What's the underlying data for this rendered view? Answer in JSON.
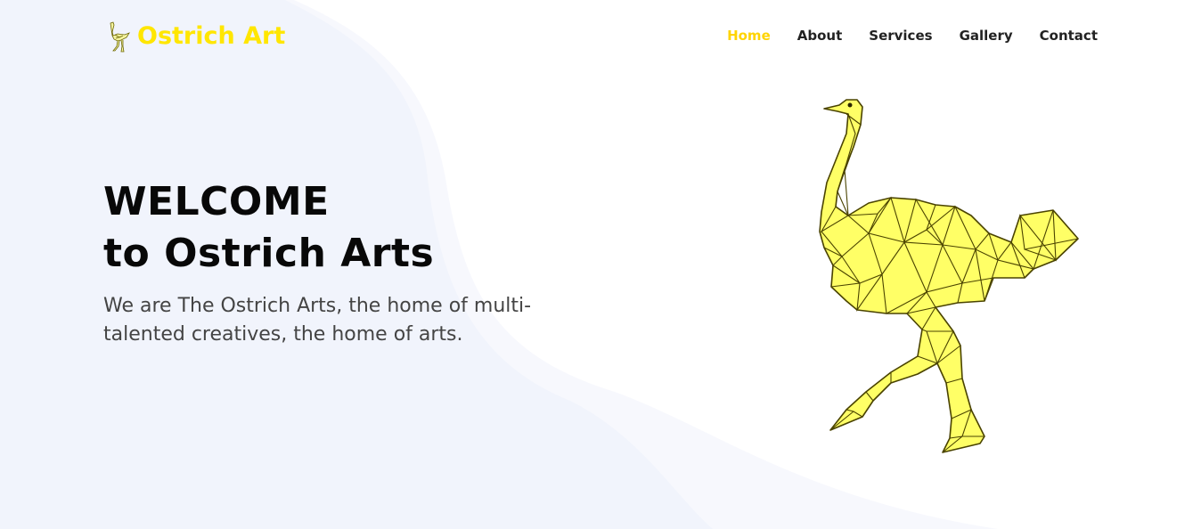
{
  "brand": {
    "name": "Ostrich Art",
    "color": "#ffe600",
    "logo_icon": "ostrich-logo-icon"
  },
  "nav": {
    "items": [
      {
        "label": "Home",
        "active": true
      },
      {
        "label": "About",
        "active": false
      },
      {
        "label": "Services",
        "active": false
      },
      {
        "label": "Gallery",
        "active": false
      },
      {
        "label": "Contact",
        "active": false
      }
    ],
    "active_color": "#ffd400"
  },
  "hero": {
    "title_line1": "WELCOME",
    "title_line2": "to Ostrich Arts",
    "subtitle": "We are The Ostrich Arts, the home of multi-talented creatives, the home of arts.",
    "illustration": "polygon-ostrich-illustration",
    "illustration_fill": "#ffff66",
    "illustration_stroke": "#4a4300"
  },
  "colors": {
    "background_shape": "#f1f4fc",
    "background_shape_light": "#f7f8fd"
  }
}
